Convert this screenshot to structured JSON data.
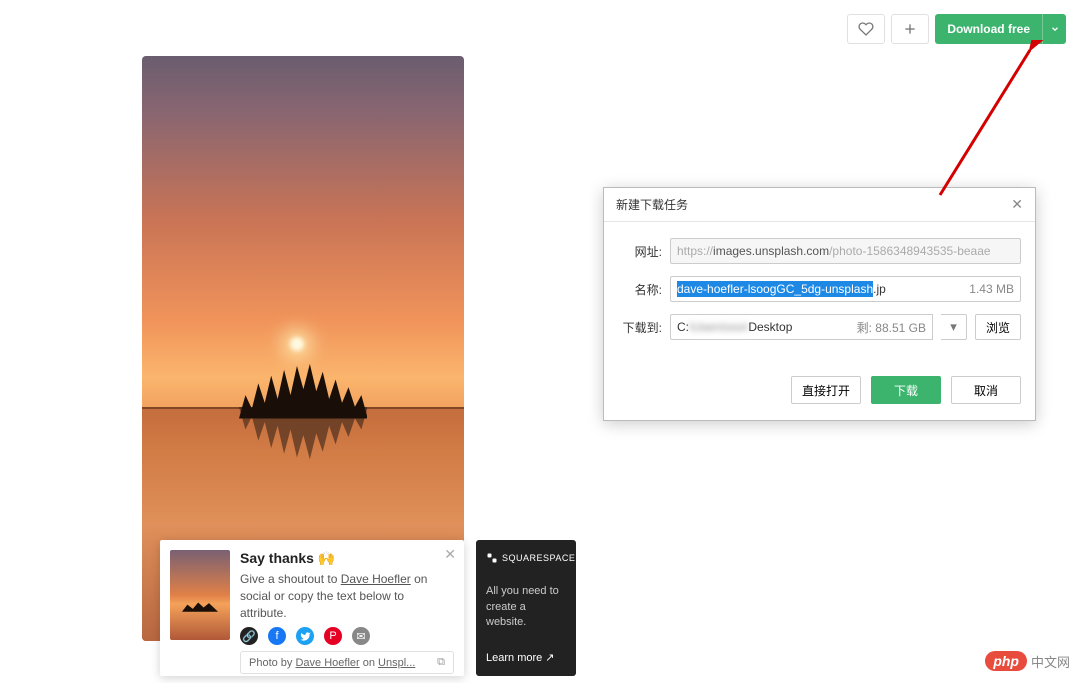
{
  "toolbar": {
    "download_label": "Download free"
  },
  "thanks": {
    "title": "Say thanks 🙌",
    "desc_prefix": "Give a shoutout to ",
    "author": "Dave Hoefler",
    "desc_suffix": " on social or copy the text below to attribute.",
    "attr_prefix": "Photo by ",
    "attr_author": "Dave Hoefler",
    "attr_mid": " on ",
    "attr_site": "Unspl..."
  },
  "ss": {
    "brand": "SQUARESPACE",
    "tagline": "All you need to create a website.",
    "learn": "Learn more ↗"
  },
  "dialog": {
    "title": "新建下载任务",
    "labels": {
      "url": "网址:",
      "name": "名称:",
      "saveto": "下载到:"
    },
    "url_prefix": "https://",
    "url_host": "images.unsplash.com",
    "url_rest": "/photo-1586348943535-beaae",
    "filename_selected": "dave-hoefler-lsoogGC_5dg-unsplash",
    "filename_ext": ".jp",
    "filesize": "1.43 MB",
    "path_drive": "C:",
    "path_mid_hidden": "\\Users\\xxx\\",
    "path_end": "Desktop",
    "remaining_label": "剩:",
    "remaining": "88.51 GB",
    "browse": "浏览",
    "open_direct": "直接打开",
    "download": "下载",
    "cancel": "取消"
  },
  "watermark": {
    "badge": "php",
    "text": "中文网"
  }
}
